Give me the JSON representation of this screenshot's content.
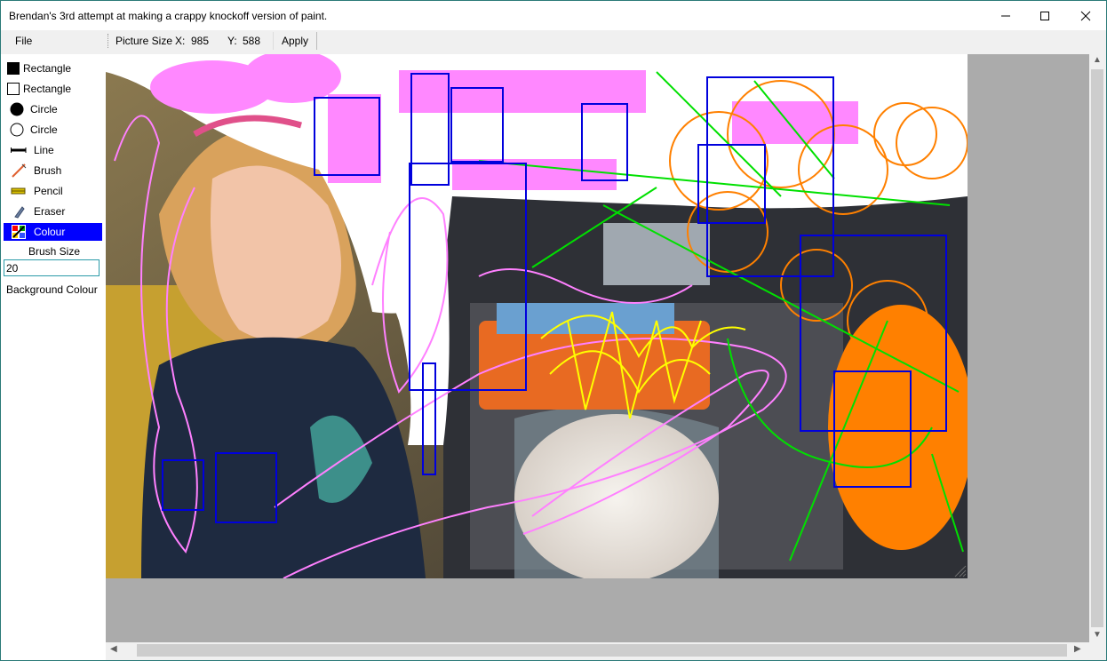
{
  "window": {
    "title": "Brendan's 3rd attempt at making a crappy knockoff version of paint."
  },
  "menu": {
    "file": "File"
  },
  "toolstrip": {
    "picture_size_label": "Picture Size",
    "x_label": "X:",
    "x_value": "985",
    "y_label": "Y:",
    "y_value": "588",
    "apply_label": "Apply"
  },
  "tools": [
    {
      "label": "Rectangle",
      "icon": "filled-rectangle-icon"
    },
    {
      "label": "Rectangle",
      "icon": "outline-rectangle-icon"
    },
    {
      "label": "Circle",
      "icon": "filled-circle-icon"
    },
    {
      "label": "Circle",
      "icon": "outline-circle-icon"
    },
    {
      "label": "Line",
      "icon": "line-icon"
    },
    {
      "label": "Brush",
      "icon": "brush-icon"
    },
    {
      "label": "Pencil",
      "icon": "pencil-icon"
    },
    {
      "label": "Eraser",
      "icon": "eraser-icon"
    },
    {
      "label": "Colour",
      "icon": "colour-palette-icon",
      "selected": true
    }
  ],
  "brush_size": {
    "label": "Brush Size",
    "value": "20"
  },
  "background_colour_label": "Background Colour",
  "colors": {
    "selection": "#0000ff",
    "window_border": "#2b7a78",
    "canvas_bg": "#ababab"
  }
}
